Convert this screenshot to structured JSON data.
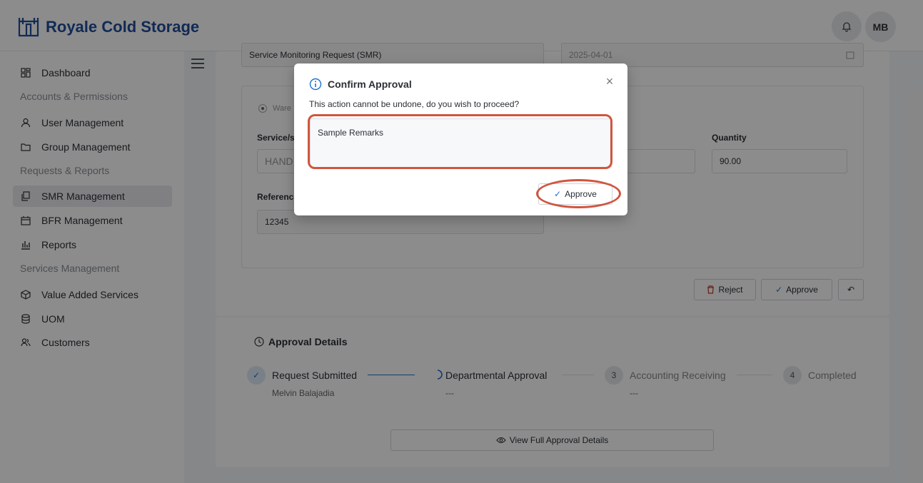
{
  "app": {
    "brand": "Royale Cold Storage",
    "user_initials": "MB"
  },
  "sidebar": {
    "items": [
      {
        "label": "Dashboard",
        "icon": "dashboard-icon"
      },
      {
        "label": "User Management",
        "icon": "user-icon"
      },
      {
        "label": "Group Management",
        "icon": "folder-icon"
      },
      {
        "label": "SMR Management",
        "icon": "copy-icon"
      },
      {
        "label": "BFR Management",
        "icon": "calendar-icon"
      },
      {
        "label": "Reports",
        "icon": "chart-icon"
      },
      {
        "label": "Value Added Services",
        "icon": "box-icon"
      },
      {
        "label": "UOM",
        "icon": "database-icon"
      },
      {
        "label": "Customers",
        "icon": "users-icon"
      }
    ],
    "sections": [
      "Accounts & Permissions",
      "Requests & Reports",
      "Services Management"
    ]
  },
  "form": {
    "request_type": "Service Monitoring Request (SMR)",
    "date": "2025-04-01",
    "radio_label": "Ware",
    "service_label": "Service/s",
    "service_value": "HAND",
    "quantity_label": "Quantity",
    "quantity_value": "90.00",
    "reference_label": "Reference",
    "reference_value": "12345"
  },
  "actions": {
    "reject": "Reject",
    "approve": "Approve"
  },
  "approval": {
    "title": "Approval Details",
    "steps": [
      {
        "number": "",
        "label": "Request Submitted",
        "sub": "Melvin Balajadia"
      },
      {
        "number": "",
        "label": "Departmental Approval",
        "sub": "---"
      },
      {
        "number": "3",
        "label": "Accounting Receiving",
        "sub": "---"
      },
      {
        "number": "4",
        "label": "Completed",
        "sub": ""
      }
    ],
    "view_full": "View Full Approval Details"
  },
  "modal": {
    "title": "Confirm Approval",
    "message": "This action cannot be undone, do you wish to proceed?",
    "remarks_value": "Sample Remarks",
    "approve_label": "Approve"
  },
  "colors": {
    "brand": "#1f4e9c",
    "highlight": "#d0553f",
    "info": "#1f6fd0"
  }
}
